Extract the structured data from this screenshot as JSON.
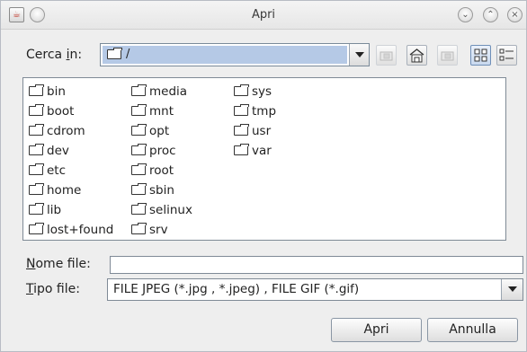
{
  "window": {
    "title": "Apri"
  },
  "titlebar": {
    "app_icon": "java-app-icon",
    "menu_icon": "window-menu-icon",
    "minimize_icon": "minimize-icon",
    "maximize_icon": "maximize-icon",
    "close_icon": "close-icon"
  },
  "lookin": {
    "label_prefix": "Cerca ",
    "label_mnemonic": "i",
    "label_suffix": "n:",
    "selected_path": "/"
  },
  "toolbar": [
    {
      "icon": "up-folder-icon",
      "enabled": false
    },
    {
      "icon": "home-icon",
      "enabled": true
    },
    {
      "icon": "new-folder-icon",
      "enabled": false
    },
    {
      "icon": "list-view-icon",
      "active": true
    },
    {
      "icon": "details-view-icon",
      "active": false
    }
  ],
  "files": {
    "col1": [
      "bin",
      "boot",
      "cdrom",
      "dev",
      "etc",
      "home",
      "lib",
      "lost+found"
    ],
    "col2": [
      "media",
      "mnt",
      "opt",
      "proc",
      "root",
      "sbin",
      "selinux",
      "srv"
    ],
    "col3": [
      "sys",
      "tmp",
      "usr",
      "var"
    ]
  },
  "filename": {
    "label_mnemonic": "N",
    "label_rest": "ome file:",
    "value": ""
  },
  "filetype": {
    "label_mnemonic": "T",
    "label_rest": "ipo file:",
    "selected": "FILE JPEG (*.jpg , *.jpeg) , FILE GIF (*.gif)"
  },
  "buttons": {
    "open": "Apri",
    "cancel": "Annulla"
  },
  "colors": {
    "selection": "#b5c9e6",
    "window_bg": "#eeeeee"
  }
}
